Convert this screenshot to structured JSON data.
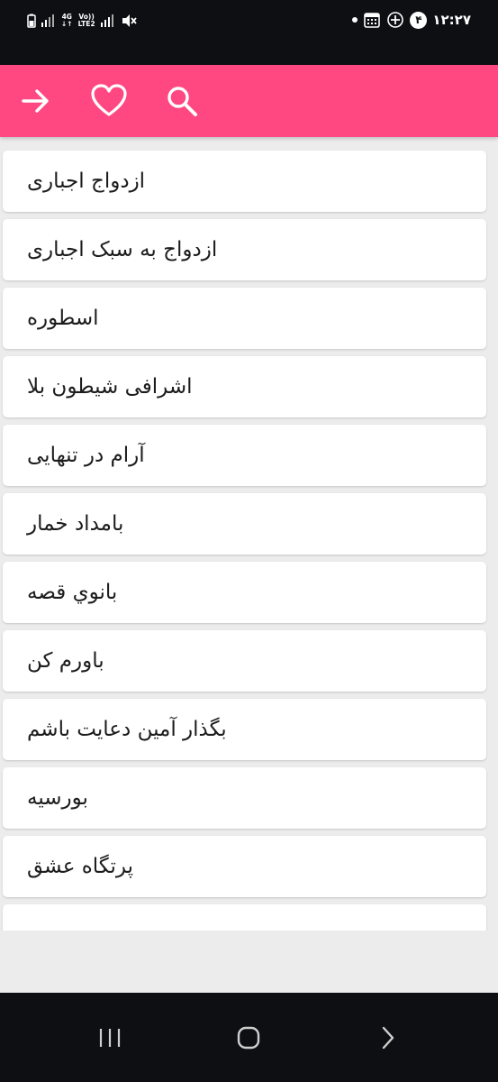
{
  "status_bar": {
    "clock": "۱۲:۲۷",
    "notification_count": "۴",
    "network_top": "4G",
    "network_bottom": "Vo))",
    "network_lte": "LTE2"
  },
  "app_bar": {
    "background": "#ff4881",
    "icons": [
      "arrow-right-icon",
      "heart-icon",
      "search-icon"
    ]
  },
  "list": {
    "items": [
      {
        "label": "ازدواج اجباری"
      },
      {
        "label": "ازدواج به سبک اجباری"
      },
      {
        "label": "اسطوره"
      },
      {
        "label": "اشرافی شیطون بلا"
      },
      {
        "label": "آرام در تنهایی"
      },
      {
        "label": "بامداد خمار"
      },
      {
        "label": "بانوي قصه"
      },
      {
        "label": "باورم کن"
      },
      {
        "label": "بگذار آمین دعایت باشم"
      },
      {
        "label": "بورسیه"
      },
      {
        "label": "پرتگاه عشق"
      }
    ]
  },
  "nav_bar": {
    "icons": [
      "recent-apps-icon",
      "home-icon",
      "back-icon"
    ]
  }
}
